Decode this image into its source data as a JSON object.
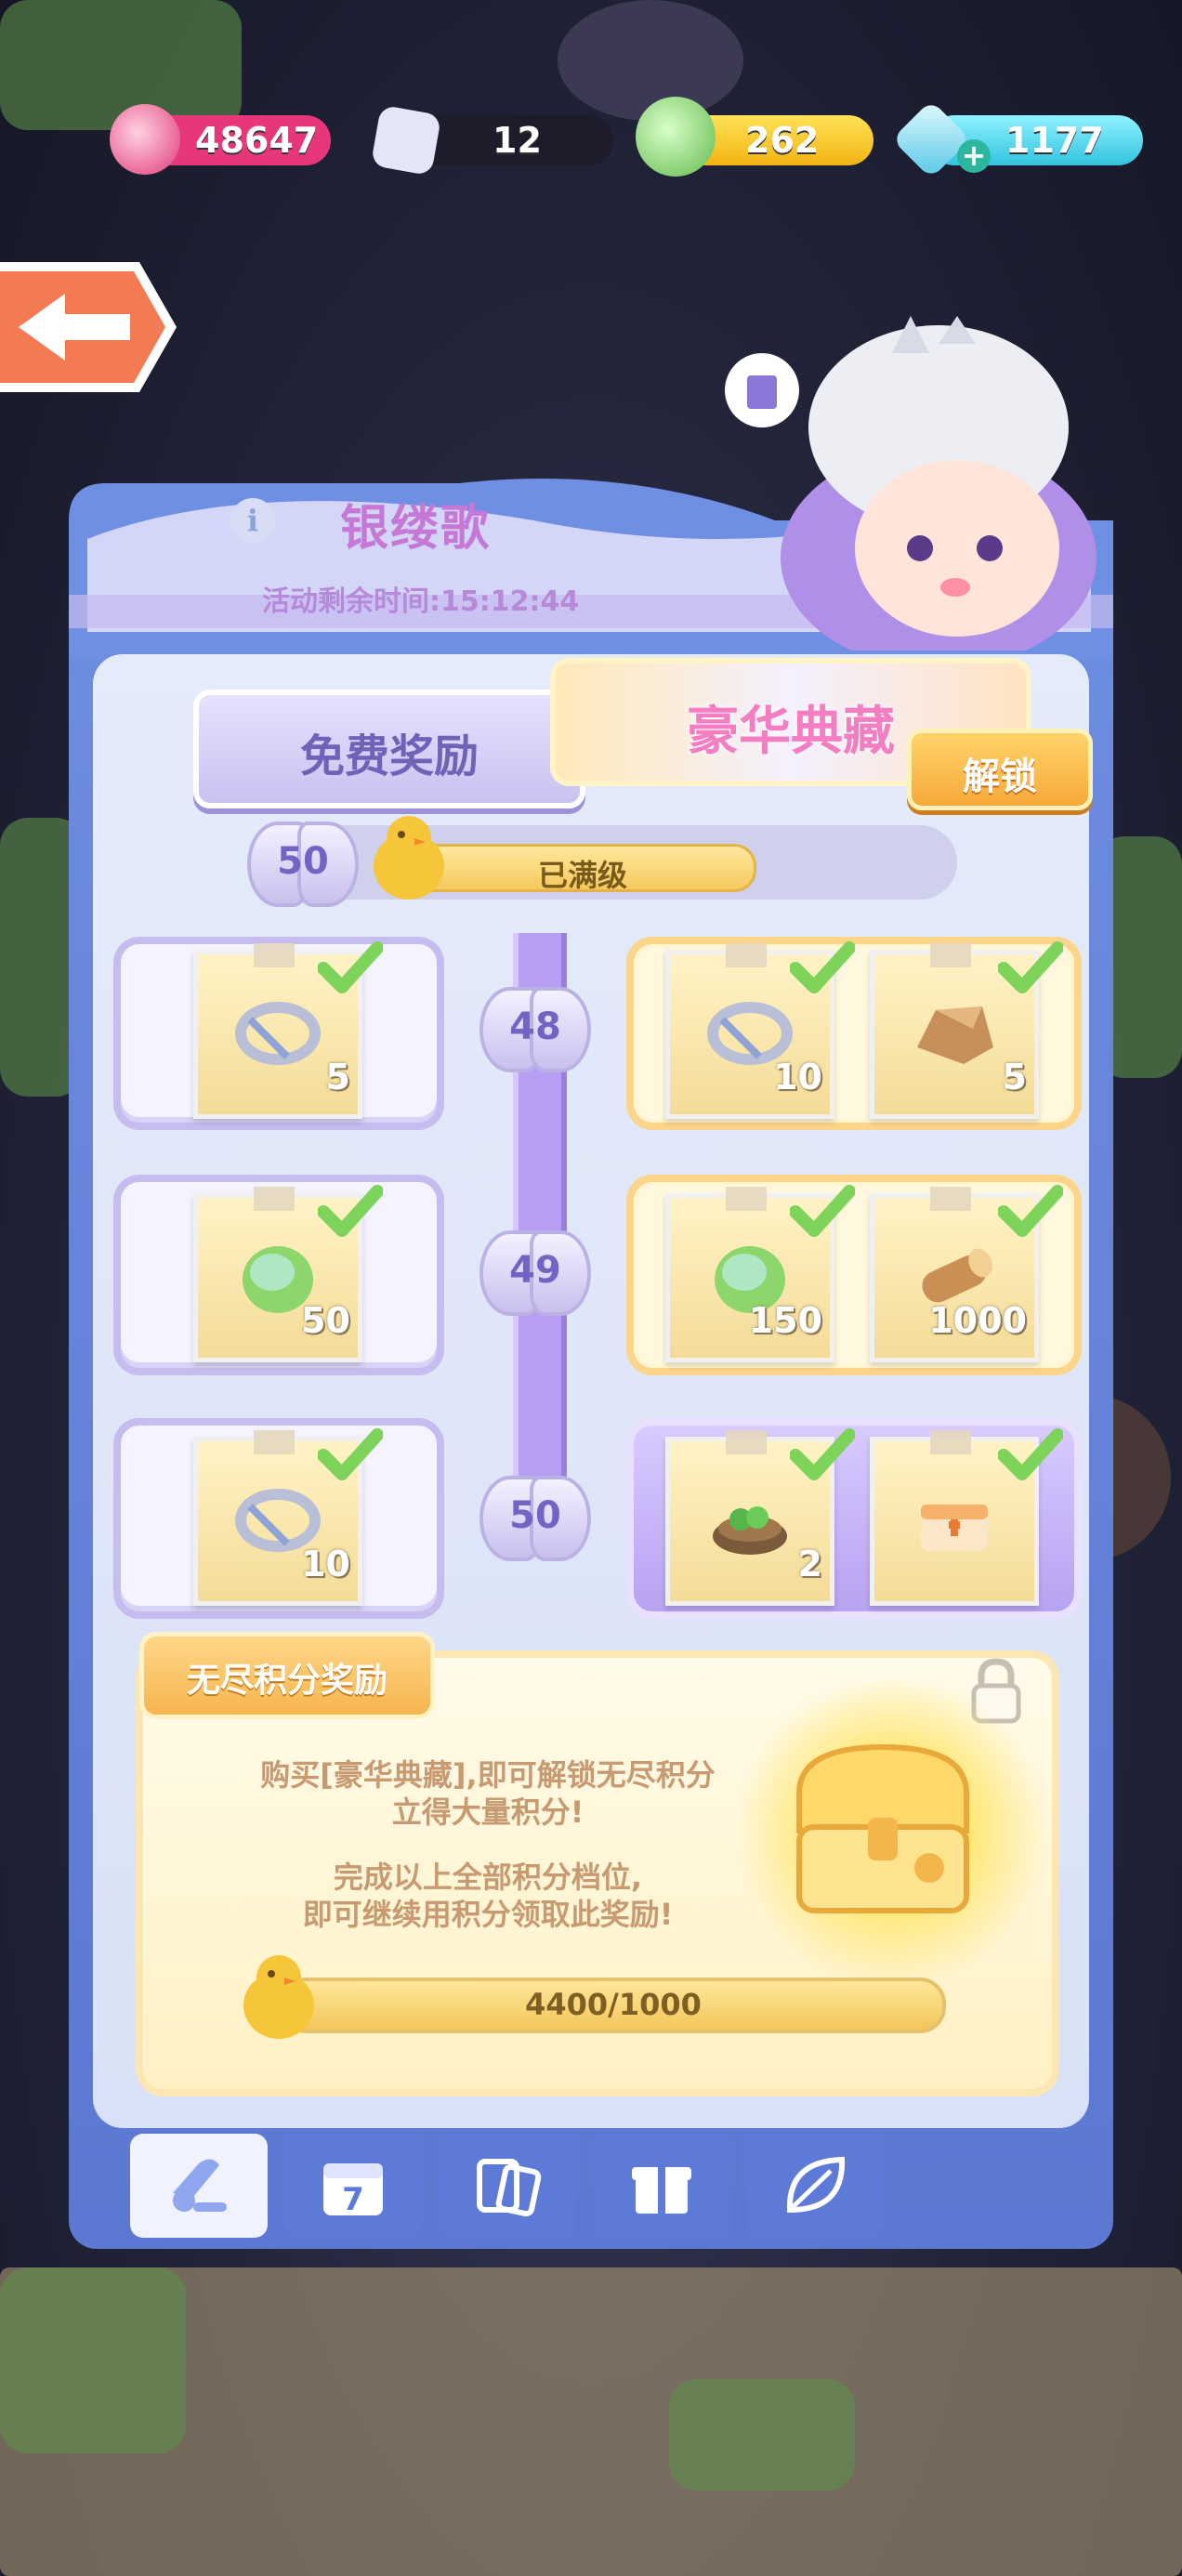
{
  "currencies": [
    {
      "name": "potion-jar",
      "value": "48647",
      "color": "#f0457f"
    },
    {
      "name": "butterfly-ticket",
      "value": "12",
      "color": "#2a2a3a"
    },
    {
      "name": "green-bean",
      "value": "262",
      "color": "#f7c62b"
    },
    {
      "name": "diamond",
      "value": "1177",
      "color": "#37c8e2"
    }
  ],
  "event": {
    "title": "银缕歌",
    "timer": "活动剩余时间:15:12:44"
  },
  "tabs": {
    "free": "免费奖励",
    "luxury": "豪华典藏",
    "unlock": "解锁"
  },
  "level": {
    "current": "50",
    "status": "已满级"
  },
  "rows": [
    {
      "level": "48",
      "free": [
        {
          "icon": "silver-ring-icon",
          "qty": "5"
        }
      ],
      "luxury": [
        {
          "icon": "silver-ring-icon",
          "qty": "10"
        },
        {
          "icon": "stone-icon",
          "qty": "5"
        }
      ]
    },
    {
      "level": "49",
      "free": [
        {
          "icon": "green-bean-icon",
          "qty": "50"
        }
      ],
      "luxury": [
        {
          "icon": "green-bean-icon",
          "qty": "150"
        },
        {
          "icon": "wood-log-icon",
          "qty": "1000"
        }
      ]
    },
    {
      "level": "50",
      "free": [
        {
          "icon": "silver-ring-icon",
          "qty": "10"
        }
      ],
      "luxury": [
        {
          "icon": "plant-pot-icon",
          "qty": "2"
        },
        {
          "icon": "toolbox-icon",
          "qty": ""
        }
      ]
    }
  ],
  "endless": {
    "tag": "无尽积分奖励",
    "line1": "购买[豪华典藏],即可解锁无尽积分",
    "line2": "立得大量积分!",
    "line3": "完成以上全部积分档位,",
    "line4": "即可继续用积分领取此奖励!",
    "progress": "4400/1000"
  },
  "bottom_tabs": [
    {
      "icon": "scroll-icon",
      "label": "",
      "active": true
    },
    {
      "icon": "calendar-icon",
      "label": "7",
      "active": false
    },
    {
      "icon": "cards-icon",
      "label": "",
      "active": false
    },
    {
      "icon": "gift-icon",
      "label": "",
      "active": false
    },
    {
      "icon": "leaf-icon",
      "label": "",
      "active": false
    }
  ]
}
